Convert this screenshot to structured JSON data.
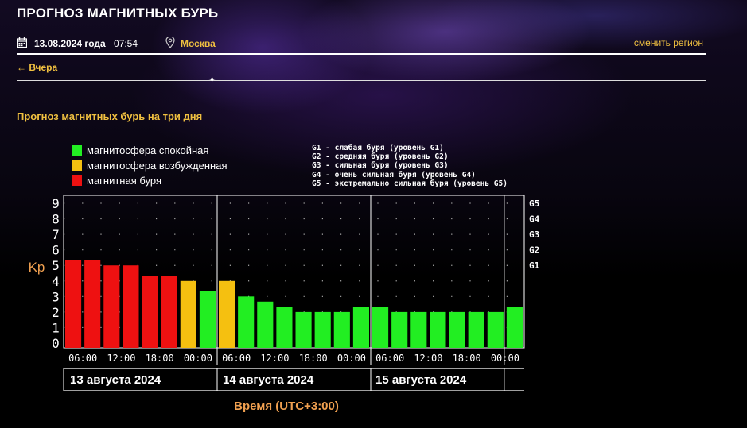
{
  "header": {
    "title": "Прогноз магнитных бурь",
    "date": "13.08.2024 года",
    "time": "07:54",
    "city": "Москва",
    "change_region": "сменить регион",
    "back_label": "← Вчера"
  },
  "section_title": "Прогноз магнитных бурь на три дня",
  "legend": {
    "items": [
      {
        "label": "магнитосфера спокойная",
        "color": "#22ee22"
      },
      {
        "label": "магнитосфера возбужденная",
        "color": "#f5c010"
      },
      {
        "label": "магнитная буря",
        "color": "#ee1111"
      }
    ],
    "storm_levels": [
      "G1 - слабая буря (уровень G1)",
      "G2 - средняя буря (уровень G2)",
      "G3 - сильная буря (уровень G3)",
      "G4 - очень сильная буря (уровень G4)",
      "G5 - экстремально сильная буря (уровень G5)"
    ]
  },
  "chart_data": {
    "type": "bar",
    "ylabel": "Kp",
    "xlabel": "Время (UTC+3:00)",
    "ylim": [
      0,
      9
    ],
    "yticks": [
      0,
      1,
      2,
      3,
      4,
      5,
      6,
      7,
      8,
      9
    ],
    "right_axis_labels": [
      {
        "label": "G1",
        "kp": 5
      },
      {
        "label": "G2",
        "kp": 6
      },
      {
        "label": "G3",
        "kp": 7
      },
      {
        "label": "G4",
        "kp": 8
      },
      {
        "label": "G5",
        "kp": 9
      }
    ],
    "time_ticks": [
      "06:00",
      "12:00",
      "18:00",
      "00:00",
      "06:00",
      "12:00",
      "18:00",
      "00:00",
      "06:00",
      "12:00",
      "18:00",
      "00:00"
    ],
    "days": [
      "13 августа 2024",
      "14 августа 2024",
      "15 августа 2024"
    ],
    "values": [
      5.33,
      5.33,
      5.0,
      5.0,
      4.33,
      4.33,
      4.0,
      3.33,
      4.0,
      3.0,
      2.67,
      2.33,
      2.0,
      2.0,
      2.0,
      2.33,
      2.33,
      2.0,
      2.0,
      2.0,
      2.0,
      2.0,
      2.0,
      2.33
    ],
    "level_colors": [
      "#ee1111",
      "#ee1111",
      "#ee1111",
      "#ee1111",
      "#ee1111",
      "#ee1111",
      "#f5c010",
      "#22ee22",
      "#f5c010",
      "#22ee22",
      "#22ee22",
      "#22ee22",
      "#22ee22",
      "#22ee22",
      "#22ee22",
      "#22ee22",
      "#22ee22",
      "#22ee22",
      "#22ee22",
      "#22ee22",
      "#22ee22",
      "#22ee22",
      "#22ee22",
      "#22ee22"
    ],
    "grid": "dotted"
  }
}
